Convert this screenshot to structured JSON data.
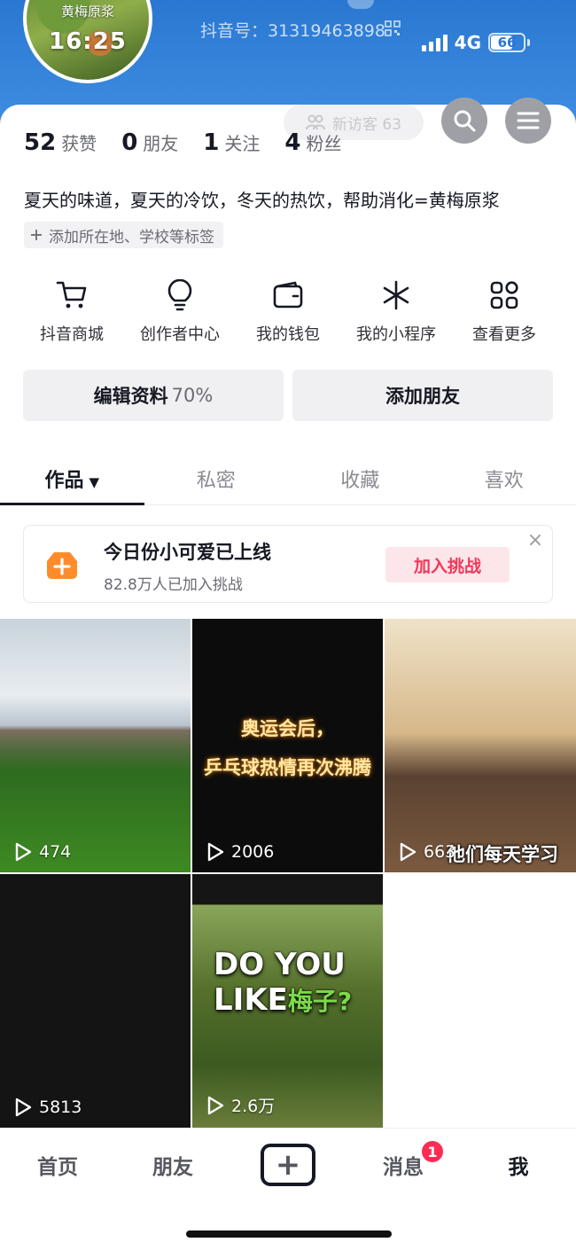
{
  "profile": {
    "avatar_caption": "黄梅原浆",
    "avatar_time": "16:25",
    "nickname": "",
    "douyin_id": "抖音号：31319463898",
    "bio": "夏天的味道，夏天的冷饮，冬天的热饮，帮助消化=黄梅原浆",
    "add_tag": "添加所在地、学校等标签"
  },
  "status_bar": {
    "network": "4G",
    "battery": "66",
    "battery_level": 0.66
  },
  "header_actions": {
    "visitors": "新访客 63"
  },
  "stats": [
    {
      "num": "52",
      "label": "获赞"
    },
    {
      "num": "0",
      "label": "朋友"
    },
    {
      "num": "1",
      "label": "关注"
    },
    {
      "num": "4",
      "label": "粉丝"
    }
  ],
  "quick_links": [
    {
      "label": "抖音商城",
      "icon": "cart-icon"
    },
    {
      "label": "创作者中心",
      "icon": "bulb-icon"
    },
    {
      "label": "我的钱包",
      "icon": "wallet-icon"
    },
    {
      "label": "我的小程序",
      "icon": "asterisk-icon"
    },
    {
      "label": "查看更多",
      "icon": "grid-icon"
    }
  ],
  "buttons": {
    "edit": "编辑资料",
    "edit_pct": "70%",
    "add_friend": "添加朋友"
  },
  "tabs": [
    "作品",
    "私密",
    "收藏",
    "喜欢"
  ],
  "challenge": {
    "title": "今日份小可爱已上线",
    "sub": "82.8万人已加入挑战",
    "join": "加入挑战",
    "close": "×"
  },
  "videos": [
    {
      "plays": "474"
    },
    {
      "plays": "2006",
      "overlay_1": "奥运会后，",
      "overlay_2": "乒乓球热情再次沸腾"
    },
    {
      "plays": "663",
      "caption": "他们每天学习"
    },
    {
      "plays": "5813"
    },
    {
      "plays": "2.6万",
      "line_1": "DO YOU",
      "line_2a": "LIKE",
      "line_2b": "梅子?"
    }
  ],
  "bottom_nav": {
    "home": "首页",
    "friends": "朋友",
    "plus": "+",
    "messages": "消息",
    "messages_badge": "1",
    "me": "我"
  }
}
